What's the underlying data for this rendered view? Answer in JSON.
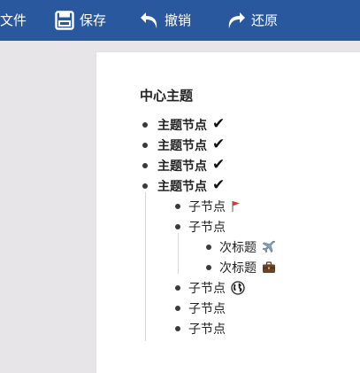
{
  "toolbar": {
    "file_label": "文件",
    "save_label": "保存",
    "undo_label": "撤销",
    "redo_label": "还原",
    "bar_color": "#2a589e"
  },
  "outline": {
    "root": "中心主题",
    "topics": [
      {
        "label": "主题节点",
        "marker": "check-icon"
      },
      {
        "label": "主题节点",
        "marker": "check-icon"
      },
      {
        "label": "主题节点",
        "marker": "check-icon"
      },
      {
        "label": "主题节点",
        "marker": "check-icon"
      }
    ],
    "subnodes": [
      {
        "label": "子节点",
        "marker": "red-flag-icon"
      },
      {
        "label": "子节点",
        "marker": ""
      },
      {
        "label": "子节点",
        "marker": "globe-icon"
      },
      {
        "label": "子节点",
        "marker": ""
      },
      {
        "label": "子节点",
        "marker": ""
      }
    ],
    "subtitles": [
      {
        "label": "次标题",
        "marker": "airplane-icon"
      },
      {
        "label": "次标题",
        "marker": "briefcase-icon"
      }
    ]
  }
}
